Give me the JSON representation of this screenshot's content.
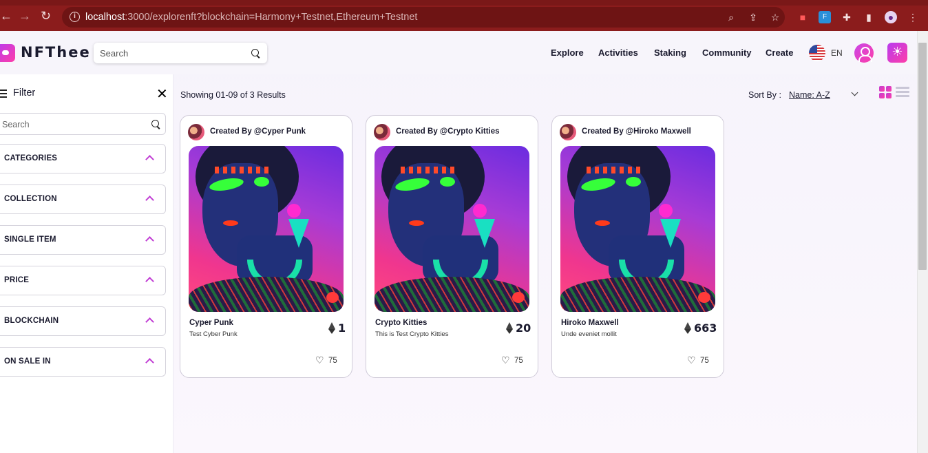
{
  "browser": {
    "url_host": "localhost",
    "url_rest": ":3000/explorenft?blockchain=Harmony+Testnet,Ethereum+Testnet"
  },
  "header": {
    "logo": "NFThee",
    "search_placeholder": "Search",
    "nav": [
      "Explore",
      "Activities",
      "Staking",
      "Community",
      "Create"
    ],
    "language": "EN"
  },
  "sidebar": {
    "title": "Filter",
    "search_placeholder": "Search",
    "sections": [
      "CATEGORIES",
      "COLLECTION",
      "SINGLE ITEM",
      "PRICE",
      "BLOCKCHAIN",
      "ON SALE IN"
    ]
  },
  "toolbar": {
    "results": "Showing 01-09 of 3 Results",
    "sort_label": "Sort By :",
    "sort_value": "Name: A-Z"
  },
  "cards": [
    {
      "creator": "Created By @Cyper Punk",
      "name": "Cyper Punk",
      "description": "Test Cyber Punk",
      "price": "1",
      "likes": "75"
    },
    {
      "creator": "Created By @Crypto Kitties",
      "name": "Crypto Kitties",
      "description": "This is Test Crypto Kitties",
      "price": "20",
      "likes": "75"
    },
    {
      "creator": "Created By @Hiroko Maxwell",
      "name": "Hiroko Maxwell",
      "description": "Unde eveniet mollit",
      "price": "663",
      "likes": "75"
    }
  ],
  "colors": {
    "accent": "#c13ed4",
    "accent2": "#ff3da8",
    "chrome": "#8b1c1c"
  }
}
